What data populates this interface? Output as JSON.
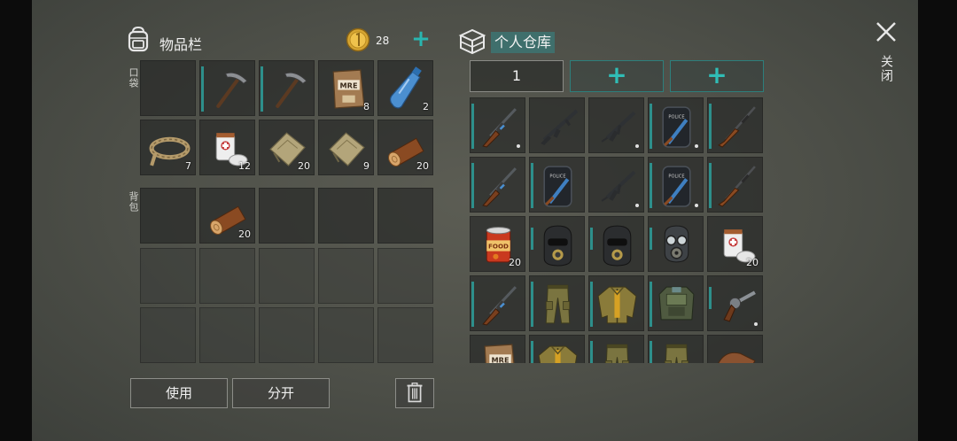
{
  "inventory": {
    "title": "物品栏",
    "coins": "28",
    "coin_add": "+",
    "pocket_label": "口袋",
    "backpack_label": "背包",
    "pocket": [
      {
        "icon": "",
        "count": ""
      },
      {
        "icon": "pickaxe-icon",
        "count": "",
        "bar": true
      },
      {
        "icon": "pickaxe-icon",
        "count": "",
        "bar": true
      },
      {
        "icon": "mre-ration-icon",
        "count": "8",
        "label": "MRE"
      },
      {
        "icon": "water-bottle-icon",
        "count": "2"
      },
      {
        "icon": "rope-icon",
        "count": "7"
      },
      {
        "icon": "bandage-icon",
        "count": "12"
      },
      {
        "icon": "cloth-icon",
        "count": "20"
      },
      {
        "icon": "cloth-icon",
        "count": "9"
      },
      {
        "icon": "log-icon",
        "count": "20"
      }
    ],
    "backpack": [
      {
        "icon": "",
        "count": ""
      },
      {
        "icon": "log-icon",
        "count": "20"
      },
      {
        "icon": "",
        "count": ""
      },
      {
        "icon": "",
        "count": ""
      },
      {
        "icon": "",
        "count": ""
      }
    ],
    "locked_rows": 2,
    "use_button": "使用",
    "split_button": "分开"
  },
  "storage": {
    "title": "个人仓库",
    "page": "1",
    "add_labels": [
      "+",
      "+"
    ],
    "items": [
      {
        "icon": "shotgun-icon",
        "bar": true,
        "dot": true
      },
      {
        "icon": "assault-rifle-icon"
      },
      {
        "icon": "smg-icon",
        "dot": true
      },
      {
        "icon": "riot-shield-icon",
        "bar": true,
        "dot": true,
        "label": "POLICE"
      },
      {
        "icon": "rifle-icon",
        "bar": true
      },
      {
        "icon": "shotgun-icon",
        "bar": true
      },
      {
        "icon": "riot-shield-icon",
        "bar": true,
        "label": "POLICE"
      },
      {
        "icon": "smg-icon",
        "dot": true
      },
      {
        "icon": "riot-shield-icon",
        "bar": true,
        "dot": true,
        "label": "POLICE"
      },
      {
        "icon": "rifle-icon",
        "bar": true
      },
      {
        "icon": "canned-food-icon",
        "count": "20",
        "label": "FOOD"
      },
      {
        "icon": "balaclava-icon",
        "bar": true,
        "short": true
      },
      {
        "icon": "balaclava-icon",
        "bar": true,
        "short": true
      },
      {
        "icon": "gas-mask-icon",
        "bar": true,
        "short": true
      },
      {
        "icon": "bandage-icon",
        "count": "20"
      },
      {
        "icon": "shotgun-icon",
        "bar": true
      },
      {
        "icon": "cargo-pants-icon",
        "bar": true
      },
      {
        "icon": "jacket-icon",
        "bar": true
      },
      {
        "icon": "armor-vest-icon",
        "bar": true
      },
      {
        "icon": "revolver-icon",
        "bar": true,
        "short": true,
        "dot": true
      },
      {
        "icon": "mre-ration-icon",
        "label": "MRE"
      },
      {
        "icon": "jacket-icon",
        "bar": true
      },
      {
        "icon": "cargo-pants-icon",
        "bar": true
      },
      {
        "icon": "cargo-pants-icon",
        "bar": true
      },
      {
        "icon": "leather-icon"
      }
    ]
  },
  "close_label": "关闭",
  "colors": {
    "accent": "#29b6b0",
    "durability_bar": "#2d8f8b",
    "storage_title_bg": "#3f6f6c"
  }
}
